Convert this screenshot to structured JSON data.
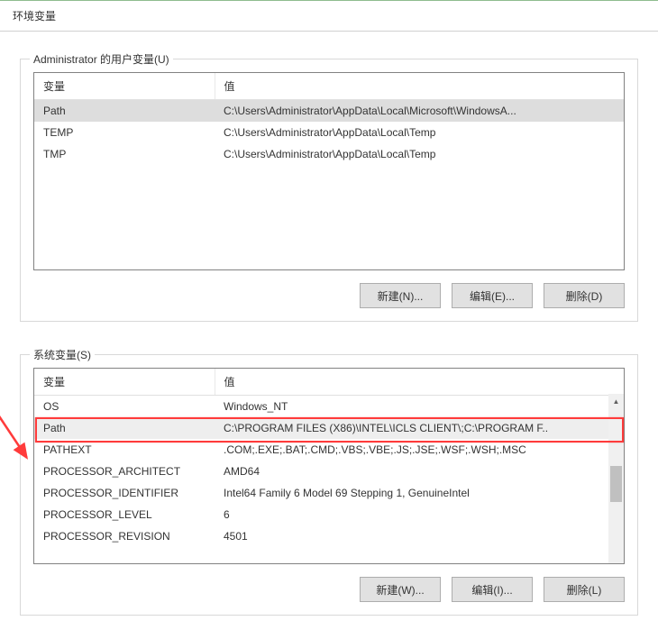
{
  "window": {
    "title": "环境变量"
  },
  "user_section": {
    "label": "Administrator 的用户变量(U)",
    "headers": {
      "variable": "变量",
      "value": "值"
    },
    "rows": [
      {
        "variable": "Path",
        "value": "C:\\Users\\Administrator\\AppData\\Local\\Microsoft\\WindowsA...",
        "selected": true
      },
      {
        "variable": "TEMP",
        "value": "C:\\Users\\Administrator\\AppData\\Local\\Temp",
        "selected": false
      },
      {
        "variable": "TMP",
        "value": "C:\\Users\\Administrator\\AppData\\Local\\Temp",
        "selected": false
      }
    ],
    "buttons": {
      "new": "新建(N)...",
      "edit": "编辑(E)...",
      "delete": "删除(D)"
    }
  },
  "system_section": {
    "label": "系统变量(S)",
    "headers": {
      "variable": "变量",
      "value": "值"
    },
    "rows": [
      {
        "variable": "OS",
        "value": "Windows_NT"
      },
      {
        "variable": "Path",
        "value": "C:\\PROGRAM FILES (X86)\\INTEL\\ICLS CLIENT\\;C:\\PROGRAM F..",
        "highlight": true
      },
      {
        "variable": "PATHEXT",
        "value": ".COM;.EXE;.BAT;.CMD;.VBS;.VBE;.JS;.JSE;.WSF;.WSH;.MSC"
      },
      {
        "variable": "PROCESSOR_ARCHITECT",
        "value": "AMD64"
      },
      {
        "variable": "PROCESSOR_IDENTIFIER",
        "value": "Intel64 Family 6 Model 69 Stepping 1, GenuineIntel"
      },
      {
        "variable": "PROCESSOR_LEVEL",
        "value": "6"
      },
      {
        "variable": "PROCESSOR_REVISION",
        "value": "4501"
      }
    ],
    "buttons": {
      "new": "新建(W)...",
      "edit": "编辑(I)...",
      "delete": "删除(L)"
    }
  }
}
